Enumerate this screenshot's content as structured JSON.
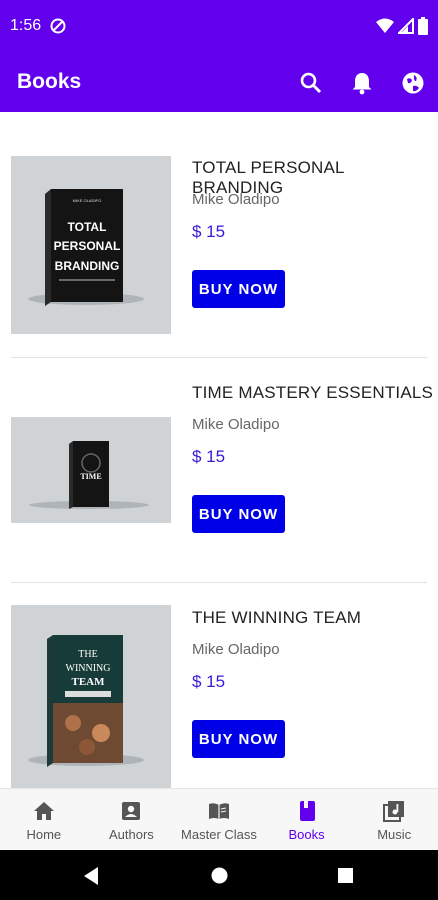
{
  "status_bar": {
    "time": "1:56"
  },
  "app_bar": {
    "title": "Books",
    "actions": [
      "search-icon",
      "bell-icon",
      "globe-icon"
    ]
  },
  "books": [
    {
      "title": "TOTAL PERSONAL BRANDING",
      "author": "Mike Oladipo",
      "price": "$ 15",
      "button": "BUY NOW",
      "cover_text": [
        "TOTAL",
        "PERSONAL",
        "BRANDING"
      ]
    },
    {
      "title": "TIME MASTERY ESSENTIALS",
      "author": "Mike Oladipo",
      "price": "$ 15",
      "button": "BUY NOW",
      "cover_text": [
        "TIME"
      ]
    },
    {
      "title": "THE WINNING TEAM",
      "author": "Mike Oladipo",
      "price": "$ 15",
      "button": "BUY NOW",
      "cover_text": [
        "THE",
        "WINNING",
        "TEAM"
      ]
    }
  ],
  "bottom_nav": [
    {
      "label": "Home",
      "icon": "home-icon"
    },
    {
      "label": "Authors",
      "icon": "person-icon"
    },
    {
      "label": "Master Class",
      "icon": "book-open-icon"
    },
    {
      "label": "Books",
      "icon": "book-icon",
      "active": true
    },
    {
      "label": "Music",
      "icon": "music-library-icon"
    }
  ],
  "colors": {
    "primary": "#6200ee",
    "button": "#0000e6",
    "price": "#3b18d6"
  }
}
